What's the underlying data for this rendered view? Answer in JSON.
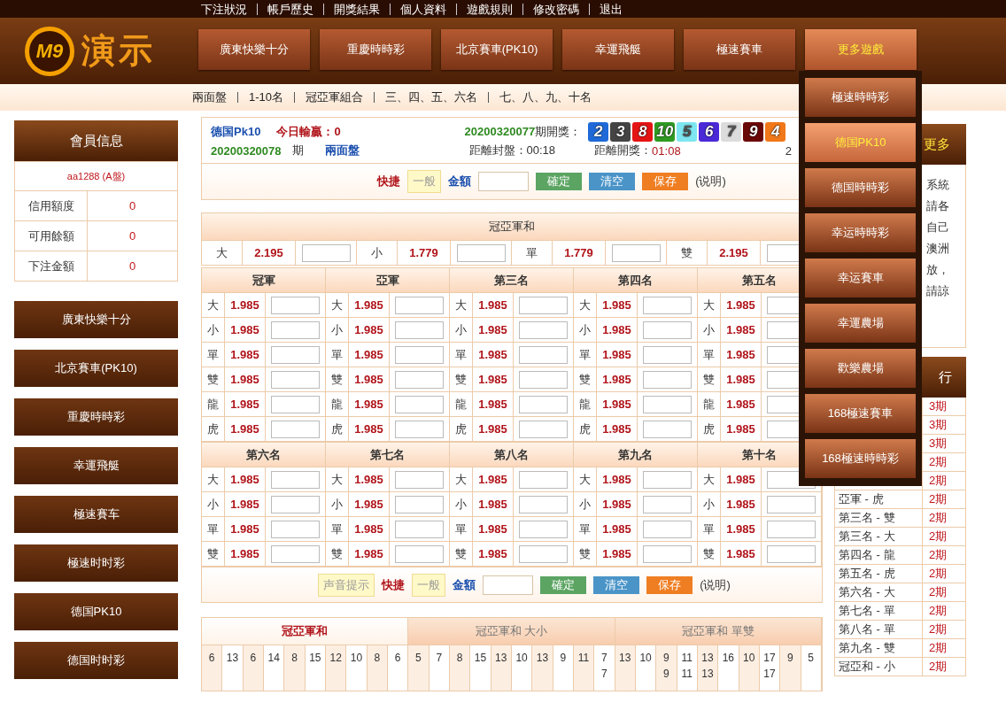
{
  "top_links": [
    "下注狀況",
    "帳戶歷史",
    "開獎結果",
    "個人資料",
    "遊戲規則",
    "修改密碼",
    "退出"
  ],
  "logo": {
    "badge": "M9",
    "title": "演示"
  },
  "nav": [
    {
      "label": "廣東快樂十分",
      "selected": false
    },
    {
      "label": "重慶時時彩",
      "selected": false
    },
    {
      "label": "北京賽車(PK10)",
      "selected": false
    },
    {
      "label": "幸運飛艇",
      "selected": false
    },
    {
      "label": "極速賽車",
      "selected": false
    },
    {
      "label": "更多遊戲",
      "selected": true
    }
  ],
  "sub_nav": [
    "兩面盤",
    "1-10名",
    "冠亞軍組合",
    "三、四、五、六名",
    "七、八、九、十名"
  ],
  "member": {
    "title": "會員信息",
    "account": "aa1288 (A盤)",
    "rows": [
      {
        "label": "信用額度",
        "value": "0"
      },
      {
        "label": "可用餘額",
        "value": "0"
      },
      {
        "label": "下注金額",
        "value": "0"
      }
    ]
  },
  "side_games": [
    "廣東快樂十分",
    "北京賽車(PK10)",
    "重慶時時彩",
    "幸運飛艇",
    "極速賽车",
    "極速时时彩",
    "德国PK10",
    "德国时时彩"
  ],
  "info": {
    "game": "德国Pk10",
    "today": "今日輸贏：0",
    "last_period": "20200320077",
    "last_label": "期開獎：",
    "balls": [
      {
        "number": "2",
        "color": "#1f6ad8"
      },
      {
        "number": "3",
        "color": "#444444"
      },
      {
        "number": "8",
        "color": "#e41414"
      },
      {
        "number": "10",
        "color": "#2f9a22"
      },
      {
        "number": "5",
        "color": "#7ee6f0"
      },
      {
        "number": "6",
        "color": "#4a2ad6"
      },
      {
        "number": "7",
        "color": "#dcdcdc"
      },
      {
        "number": "9",
        "color": "#6a0808"
      },
      {
        "number": "4",
        "color": "#f07818"
      }
    ],
    "period": "20200320078",
    "period_label": "期",
    "mode": "兩面盤",
    "close_label": "距離封盤：00:18",
    "draw_label": "距離開獎：",
    "draw_time": "01:08",
    "extra": "2"
  },
  "controls_top": {
    "quick_label": "快捷",
    "quick_mode": "一般",
    "amount_label": "金額",
    "buttons": [
      {
        "label": "確定",
        "kind": "confirm"
      },
      {
        "label": "清空",
        "kind": "clear"
      },
      {
        "label": "保存",
        "kind": "save"
      }
    ],
    "note": "(说明)"
  },
  "sum_table": {
    "title": "冠亞軍和",
    "cells": [
      {
        "label": "大",
        "odds": "2.195"
      },
      {
        "label": "小",
        "odds": "1.779"
      },
      {
        "label": "單",
        "odds": "1.779"
      },
      {
        "label": "雙",
        "odds": "2.195"
      }
    ]
  },
  "rank_groups": [
    {
      "columns": [
        {
          "title": "冠軍",
          "rows": [
            {
              "label": "大",
              "odds": "1.985"
            },
            {
              "label": "小",
              "odds": "1.985"
            },
            {
              "label": "單",
              "odds": "1.985"
            },
            {
              "label": "雙",
              "odds": "1.985"
            },
            {
              "label": "龍",
              "odds": "1.985"
            },
            {
              "label": "虎",
              "odds": "1.985"
            }
          ]
        },
        {
          "title": "亞軍",
          "rows": [
            {
              "label": "大",
              "odds": "1.985"
            },
            {
              "label": "小",
              "odds": "1.985"
            },
            {
              "label": "單",
              "odds": "1.985"
            },
            {
              "label": "雙",
              "odds": "1.985"
            },
            {
              "label": "龍",
              "odds": "1.985"
            },
            {
              "label": "虎",
              "odds": "1.985"
            }
          ]
        },
        {
          "title": "第三名",
          "rows": [
            {
              "label": "大",
              "odds": "1.985"
            },
            {
              "label": "小",
              "odds": "1.985"
            },
            {
              "label": "單",
              "odds": "1.985"
            },
            {
              "label": "雙",
              "odds": "1.985"
            },
            {
              "label": "龍",
              "odds": "1.985"
            },
            {
              "label": "虎",
              "odds": "1.985"
            }
          ]
        },
        {
          "title": "第四名",
          "rows": [
            {
              "label": "大",
              "odds": "1.985"
            },
            {
              "label": "小",
              "odds": "1.985"
            },
            {
              "label": "單",
              "odds": "1.985"
            },
            {
              "label": "雙",
              "odds": "1.985"
            },
            {
              "label": "龍",
              "odds": "1.985"
            },
            {
              "label": "虎",
              "odds": "1.985"
            }
          ]
        },
        {
          "title": "第五名",
          "rows": [
            {
              "label": "大",
              "odds": "1.985"
            },
            {
              "label": "小",
              "odds": "1.985"
            },
            {
              "label": "單",
              "odds": "1.985"
            },
            {
              "label": "雙",
              "odds": "1.985"
            },
            {
              "label": "龍",
              "odds": "1.985"
            },
            {
              "label": "虎",
              "odds": "1.985"
            }
          ]
        }
      ]
    },
    {
      "columns": [
        {
          "title": "第六名",
          "rows": [
            {
              "label": "大",
              "odds": "1.985"
            },
            {
              "label": "小",
              "odds": "1.985"
            },
            {
              "label": "單",
              "odds": "1.985"
            },
            {
              "label": "雙",
              "odds": "1.985"
            }
          ]
        },
        {
          "title": "第七名",
          "rows": [
            {
              "label": "大",
              "odds": "1.985"
            },
            {
              "label": "小",
              "odds": "1.985"
            },
            {
              "label": "單",
              "odds": "1.985"
            },
            {
              "label": "雙",
              "odds": "1.985"
            }
          ]
        },
        {
          "title": "第八名",
          "rows": [
            {
              "label": "大",
              "odds": "1.985"
            },
            {
              "label": "小",
              "odds": "1.985"
            },
            {
              "label": "單",
              "odds": "1.985"
            },
            {
              "label": "雙",
              "odds": "1.985"
            }
          ]
        },
        {
          "title": "第九名",
          "rows": [
            {
              "label": "大",
              "odds": "1.985"
            },
            {
              "label": "小",
              "odds": "1.985"
            },
            {
              "label": "單",
              "odds": "1.985"
            },
            {
              "label": "雙",
              "odds": "1.985"
            }
          ]
        },
        {
          "title": "第十名",
          "rows": [
            {
              "label": "大",
              "odds": "1.985"
            },
            {
              "label": "小",
              "odds": "1.985"
            },
            {
              "label": "單",
              "odds": "1.985"
            },
            {
              "label": "雙",
              "odds": "1.985"
            }
          ]
        }
      ]
    }
  ],
  "controls_bottom": {
    "sound": "声音提示",
    "quick_label": "快捷",
    "quick_mode": "一般",
    "amount_label": "金額",
    "buttons": [
      {
        "label": "確定",
        "kind": "confirm"
      },
      {
        "label": "清空",
        "kind": "clear"
      },
      {
        "label": "保存",
        "kind": "save"
      }
    ],
    "note": "(说明)"
  },
  "stats": {
    "tabs": [
      {
        "label": "冠亞軍和",
        "selected": true
      },
      {
        "label": "冠亞軍和 大小",
        "selected": false
      },
      {
        "label": "冠亞軍和 單雙",
        "selected": false
      }
    ],
    "cells": [
      [
        "6"
      ],
      [
        "13"
      ],
      [
        "6"
      ],
      [
        "14"
      ],
      [
        "8"
      ],
      [
        "15"
      ],
      [
        "12"
      ],
      [
        "10"
      ],
      [
        "8"
      ],
      [
        "6"
      ],
      [
        "5"
      ],
      [
        "7"
      ],
      [
        "8"
      ],
      [
        "15"
      ],
      [
        "13"
      ],
      [
        "10"
      ],
      [
        "13"
      ],
      [
        "9"
      ],
      [
        "11"
      ],
      [
        "7",
        "7"
      ],
      [
        "13"
      ],
      [
        "10"
      ],
      [
        "9",
        "9"
      ],
      [
        "11",
        "11"
      ],
      [
        "13",
        "13"
      ],
      [
        "16"
      ],
      [
        "10"
      ],
      [
        "17",
        "17"
      ],
      [
        "9"
      ],
      [
        "5"
      ]
    ]
  },
  "notice": {
    "title": "更多",
    "lines": [
      "系統",
      "請各",
      "自己",
      "澳洲",
      "放，",
      "請諒"
    ]
  },
  "streak": {
    "title": "行",
    "rows": [
      {
        "period": "3期"
      },
      {
        "period": "3期"
      },
      {
        "period": "3期"
      },
      {
        "period": "2期"
      },
      {
        "period": "2期"
      },
      {
        "name": "亞軍 - 虎",
        "period": "2期"
      },
      {
        "name": "第三名 - 雙",
        "period": "2期"
      },
      {
        "name": "第三名 - 大",
        "period": "2期"
      },
      {
        "name": "第四名 - 龍",
        "period": "2期"
      },
      {
        "name": "第五名 - 虎",
        "period": "2期"
      },
      {
        "name": "第六名 - 大",
        "period": "2期"
      },
      {
        "name": "第七名 - 單",
        "period": "2期"
      },
      {
        "name": "第八名 - 單",
        "period": "2期"
      },
      {
        "name": "第九名 - 雙",
        "period": "2期"
      },
      {
        "name": "冠亞和 - 小",
        "period": "2期"
      }
    ]
  },
  "dropdown": [
    {
      "label": "極速時時彩",
      "selected": false
    },
    {
      "label": "德国PK10",
      "selected": true
    },
    {
      "label": "德国時時彩",
      "selected": false
    },
    {
      "label": "幸运時時彩",
      "selected": false
    },
    {
      "label": "幸运賽車",
      "selected": false
    },
    {
      "label": "幸運農場",
      "selected": false
    },
    {
      "label": "歡樂農場",
      "selected": false
    },
    {
      "label": "168極速賽車",
      "selected": false
    },
    {
      "label": "168極速時時彩",
      "selected": false
    }
  ]
}
